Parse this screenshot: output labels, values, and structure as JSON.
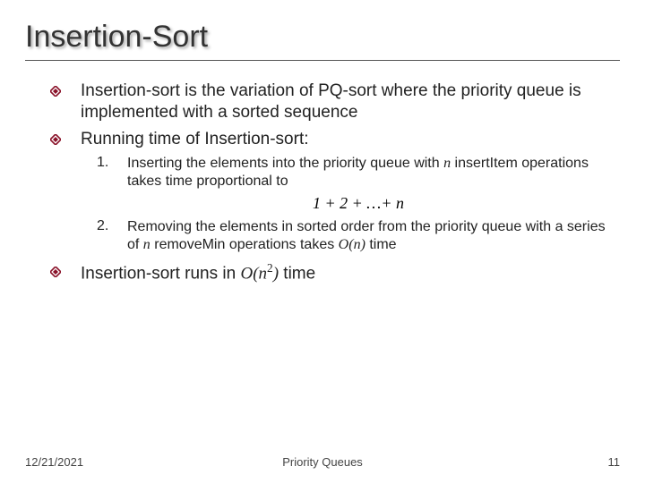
{
  "title": "Insertion-Sort",
  "bullets": {
    "b1": "Insertion-sort is the variation of PQ-sort where the priority queue is implemented with a sorted sequence",
    "b2": "Running time of Insertion-sort:",
    "b3_pre": "Insertion-sort runs in ",
    "b3_bigO": "O",
    "b3_paren_open": "(",
    "b3_n": "n",
    "b3_exp": "2",
    "b3_paren_close": ")",
    "b3_post": " time"
  },
  "numbered": {
    "n1_label": "1.",
    "n1_pre": "Inserting the elements into the priority queue with ",
    "n1_var": "n",
    "n1_post": " insertItem operations takes time proportional to",
    "formula": "1 + 2 + …+ n",
    "n2_label": "2.",
    "n2_pre": "Removing the elements in sorted order from the priority queue with  a series of ",
    "n2_var": "n",
    "n2_mid": " removeMin operations takes ",
    "n2_bigO": "O",
    "n2_paren_open": "(",
    "n2_n": "n",
    "n2_paren_close": ")",
    "n2_post": " time"
  },
  "footer": {
    "date": "12/21/2021",
    "center": "Priority Queues",
    "page": "11"
  }
}
